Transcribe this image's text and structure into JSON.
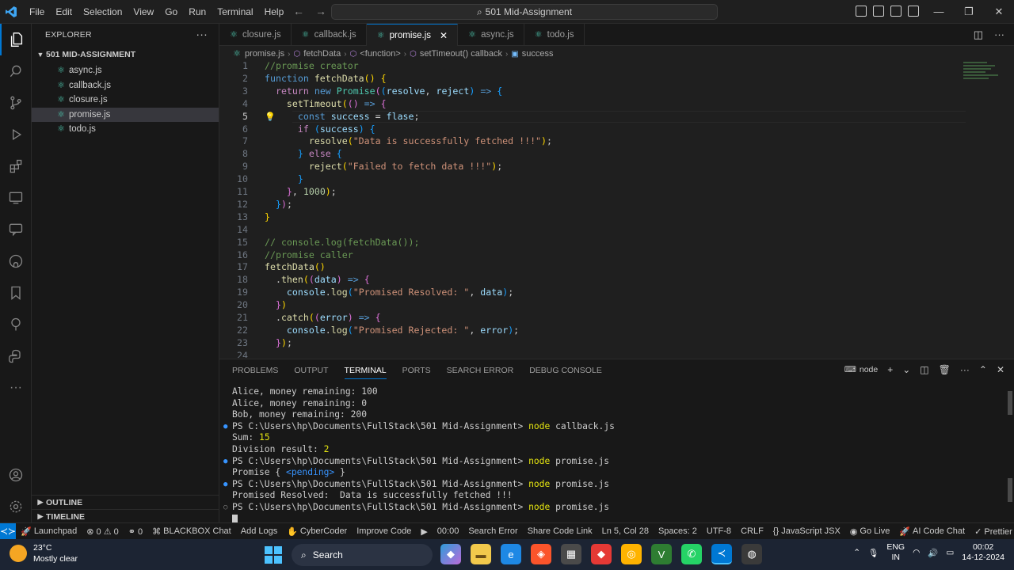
{
  "titlebar": {
    "menu": [
      "File",
      "Edit",
      "Selection",
      "View",
      "Go",
      "Run",
      "Terminal",
      "Help"
    ],
    "search_text": "501 Mid-Assignment"
  },
  "sidebar": {
    "header": "EXPLORER",
    "folder": "501 MID-ASSIGNMENT",
    "files": [
      "async.js",
      "callback.js",
      "closure.js",
      "promise.js",
      "todo.js"
    ],
    "selected": "promise.js",
    "outline": "OUTLINE",
    "timeline": "TIMELINE"
  },
  "tabs": [
    "closure.js",
    "callback.js",
    "promise.js",
    "async.js",
    "todo.js"
  ],
  "active_tab": "promise.js",
  "breadcrumbs": [
    "promise.js",
    "fetchData",
    "<function>",
    "setTimeout() callback",
    "success"
  ],
  "editor": {
    "current_line": 5,
    "line_numbers": [
      "1",
      "2",
      "3",
      "4",
      "5",
      "6",
      "7",
      "8",
      "9",
      "10",
      "11",
      "12",
      "13",
      "14",
      "15",
      "16",
      "17",
      "18",
      "19",
      "20",
      "21",
      "22",
      "23",
      "24"
    ]
  },
  "panel": {
    "tabs": [
      "PROBLEMS",
      "OUTPUT",
      "TERMINAL",
      "PORTS",
      "SEARCH ERROR",
      "DEBUG CONSOLE"
    ],
    "active": "TERMINAL",
    "shell": "node",
    "terminal_lines": [
      "Alice, money remaining: 100",
      "Alice, money remaining: 0",
      "Bob, money remaining: 200",
      "PS C:\\Users\\hp\\Documents\\FullStack\\501 Mid-Assignment> node callback.js",
      "Sum: 15",
      "Division result: 2",
      "PS C:\\Users\\hp\\Documents\\FullStack\\501 Mid-Assignment> node promise.js",
      "Promise { <pending> }",
      "PS C:\\Users\\hp\\Documents\\FullStack\\501 Mid-Assignment> node promise.js",
      "Promised Resolved:  Data is successfully fetched !!!",
      "PS C:\\Users\\hp\\Documents\\FullStack\\501 Mid-Assignment> node promise.js"
    ]
  },
  "statusbar": {
    "left": [
      "Launchpad",
      "⊗ 0 ⚠ 0",
      "⚭ 0",
      "BLACKBOX Chat",
      "Add Logs",
      "CyberCoder",
      "Improve Code",
      "▶",
      "00:00",
      "Search Error",
      "Share Code Link"
    ],
    "right": [
      "Ln 5, Col 28",
      "Spaces: 2",
      "UTF-8",
      "CRLF",
      "{} JavaScript JSX",
      "Go Live",
      "AI Code Chat",
      "✓ Prettier"
    ]
  },
  "taskbar": {
    "temp": "23°C",
    "weather": "Mostly clear",
    "search": "Search",
    "lang1": "ENG",
    "lang2": "IN",
    "time": "00:02",
    "date": "14-12-2024"
  },
  "colors": {
    "accent": "#0078d4",
    "editor_bg": "#1f1f1f",
    "sidebar_bg": "#181818",
    "taskbar_bg": "#1c2433"
  }
}
